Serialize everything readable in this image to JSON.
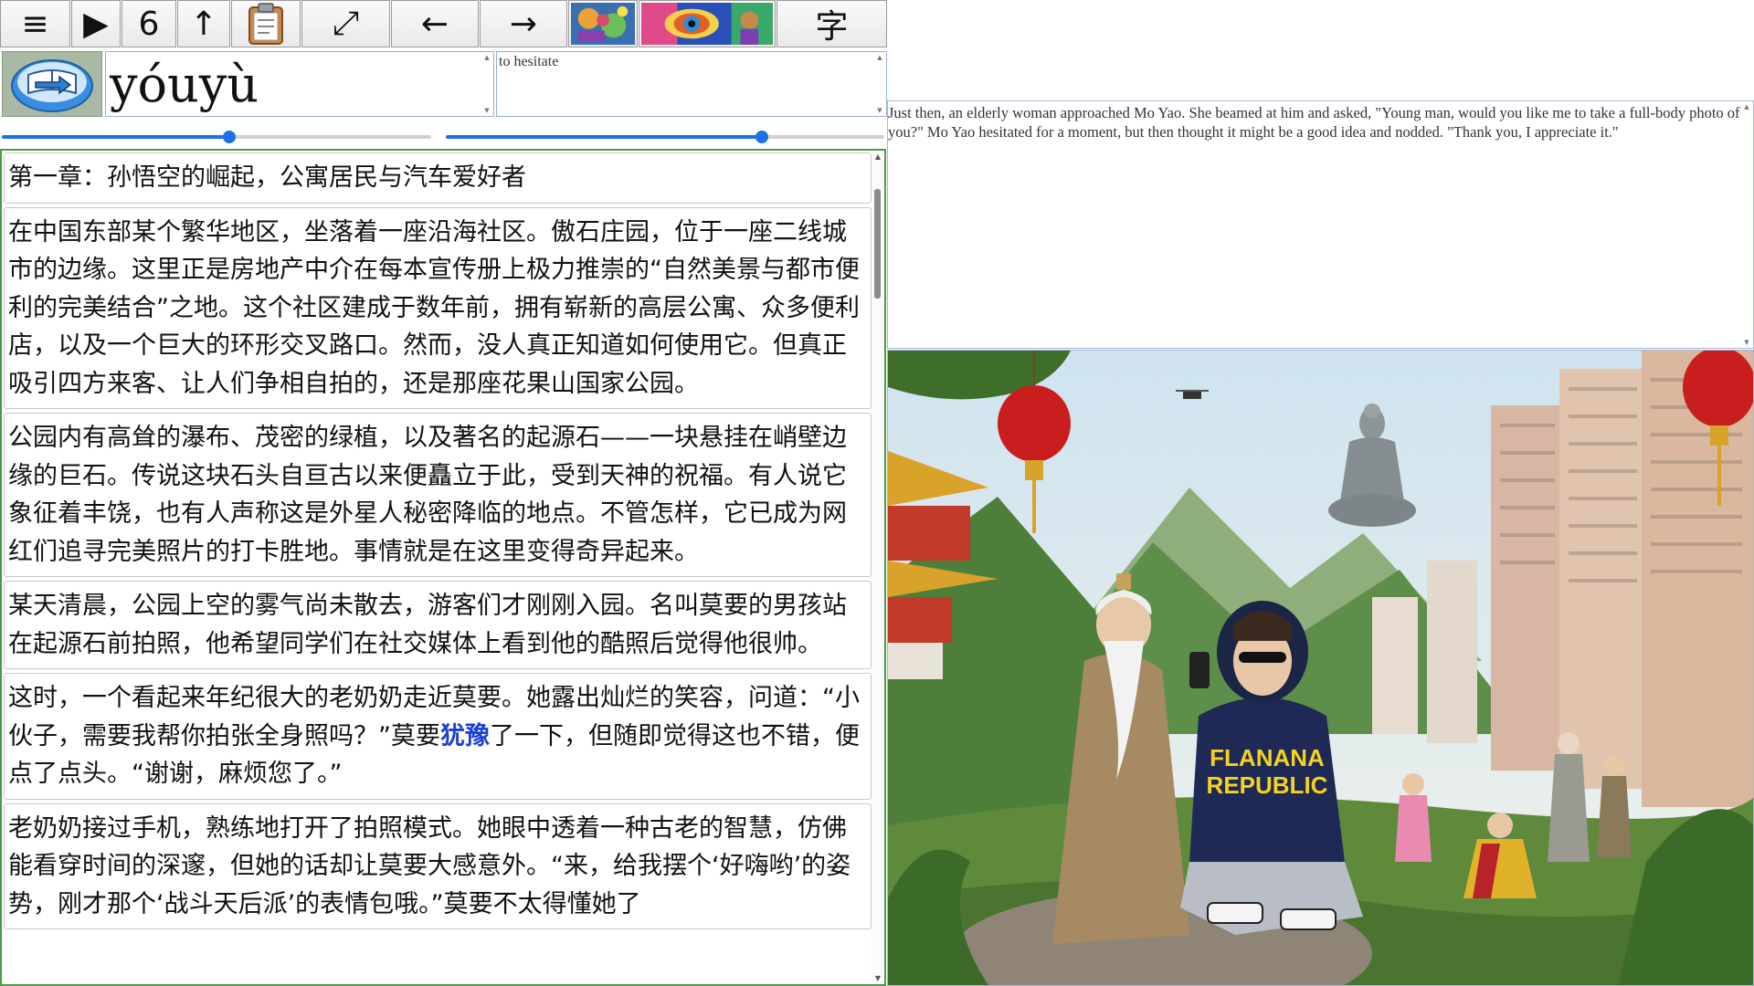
{
  "toolbar": {
    "buttons": [
      {
        "name": "menu",
        "icon": "hamburger-icon",
        "glyph": "≡"
      },
      {
        "name": "play",
        "icon": "play-icon",
        "glyph": "▶"
      },
      {
        "name": "count",
        "label": "6"
      },
      {
        "name": "up",
        "icon": "up-arrow-icon",
        "glyph": "↑"
      },
      {
        "name": "clipboard",
        "icon": "clipboard-icon",
        "glyph": "📋"
      },
      {
        "name": "expand",
        "icon": "expand-icon",
        "glyph": "⤢"
      },
      {
        "name": "prev",
        "icon": "left-arrow-icon",
        "glyph": "←"
      },
      {
        "name": "next",
        "icon": "right-arrow-icon",
        "glyph": "→"
      },
      {
        "name": "image-a",
        "icon": "colorful-art-icon"
      },
      {
        "name": "image-b",
        "icon": "psychedelic-eye-icon"
      },
      {
        "name": "char-mode",
        "label": "字"
      }
    ]
  },
  "word": {
    "pinyin": "yóuyù",
    "meaning": "to hesitate"
  },
  "sliders": {
    "left_value": 0.53,
    "right_value": 0.72,
    "accent": "#1a73e8"
  },
  "reader": {
    "paragraphs": [
      {
        "text": "第一章：孙悟空的崛起，公寓居民与汽车爱好者"
      },
      {
        "text": "在中国东部某个繁华地区，坐落着一座沿海社区。傲石庄园，位于一座二线城市的边缘。这里正是房地产中介在每本宣传册上极力推崇的“自然美景与都市便利的完美结合”之地。这个社区建成于数年前，拥有崭新的高层公寓、众多便利店，以及一个巨大的环形交叉路口。然而，没人真正知道如何使用它。但真正吸引四方来客、让人们争相自拍的，还是那座花果山国家公园。"
      },
      {
        "text": "公园内有高耸的瀑布、茂密的绿植，以及著名的起源石——一块悬挂在峭壁边缘的巨石。传说这块石头自亘古以来便矗立于此，受到天神的祝福。有人说它象征着丰饶，也有人声称这是外星人秘密降临的地点。不管怎样，它已成为网红们追寻完美照片的打卡胜地。事情就是在这里变得奇异起来。"
      },
      {
        "text": "某天清晨，公园上空的雾气尚未散去，游客们才刚刚入园。名叫莫要的男孩站在起源石前拍照，他希望同学们在社交媒体上看到他的酷照后觉得他很帅。"
      },
      {
        "pre": "这时，一个看起来年纪很大的老奶奶走近莫要。她露出灿烂的笑容，问道：“小伙子，需要我帮你拍张全身照吗？”莫要",
        "highlight": "犹豫",
        "post": "了一下，但随即觉得这也不错，便点了点头。“谢谢，麻烦您了。”"
      },
      {
        "text": "老奶奶接过手机，熟练地打开了拍照模式。她眼中透着一种古老的智慧，仿佛能看穿时间的深邃，但她的话却让莫要大感意外。“来，给我摆个‘好嗨哟’的姿势，刚才那个‘战斗天后派’的表情包哦。”莫要不太得懂她了"
      }
    ],
    "highlight_color": "#1a3fd6"
  },
  "translation": {
    "text": "Just then, an elderly woman approached Mo Yao. She beamed at him and asked, \"Young man, would you like me to take a full-body photo of you?\" Mo Yao hesitated for a moment, but then thought it might be a good idea and nodded. \"Thank you, I appreciate it.\""
  },
  "illustration": {
    "hoodie_text_line1": "FLANANA",
    "hoodie_text_line2": "REPUBLIC"
  }
}
